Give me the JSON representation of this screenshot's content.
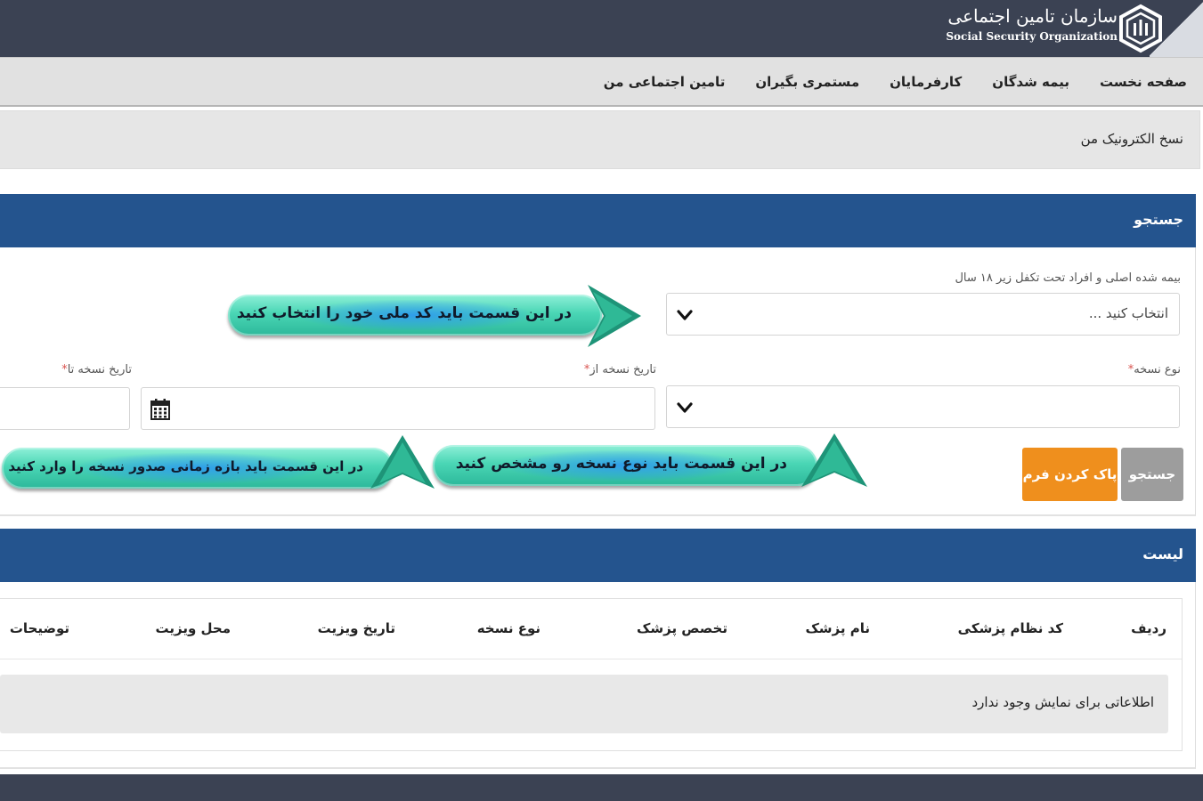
{
  "header": {
    "org_name_fa": "سازمان تامین اجتماعی",
    "org_name_en": "Social Security Organization"
  },
  "nav": {
    "items": [
      "صفحه نخست",
      "بیمه شدگان",
      "کارفرمایان",
      "مستمری بگیران",
      "تامین اجتماعی من"
    ]
  },
  "breadcrumb": {
    "title": "نسخ الکترونیک من"
  },
  "search_panel": {
    "title": "جستجو",
    "insured_label": "بیمه شده اصلی و افراد تحت تکفل زیر ۱۸ سال",
    "insured_placeholder": "انتخاب کنید ...",
    "type_label": "نوع نسخه",
    "date_from_label": "تاریخ نسخه از",
    "date_to_label": "تاریخ نسخه تا",
    "required_mark": "*",
    "search_button": "جستجو",
    "clear_button": "پاک کردن فرم"
  },
  "list_panel": {
    "title": "لیست",
    "columns": [
      "ردیف",
      "کد نظام پزشکی",
      "نام پزشک",
      "تخصص پزشک",
      "نوع نسخه",
      "تاریخ ویزیت",
      "محل ویزیت",
      "توضیحات"
    ],
    "empty_message": "اطلاعاتی برای نمایش وجود ندارد"
  },
  "annotations": {
    "national_code": "در این قسمت باید کد ملی خود را انتخاب کنید",
    "type": "در این قسمت باید نوع نسخه رو مشخص کنید",
    "date_range": "در این قسمت باید بازه زمانی صدور نسخه را وارد کنید"
  },
  "colors": {
    "header_bg": "#3b4253",
    "panel_head": "#24548e",
    "clear_button": "#ef8f1d",
    "search_button": "#9d9d9d",
    "callout": "#3dcfae"
  }
}
